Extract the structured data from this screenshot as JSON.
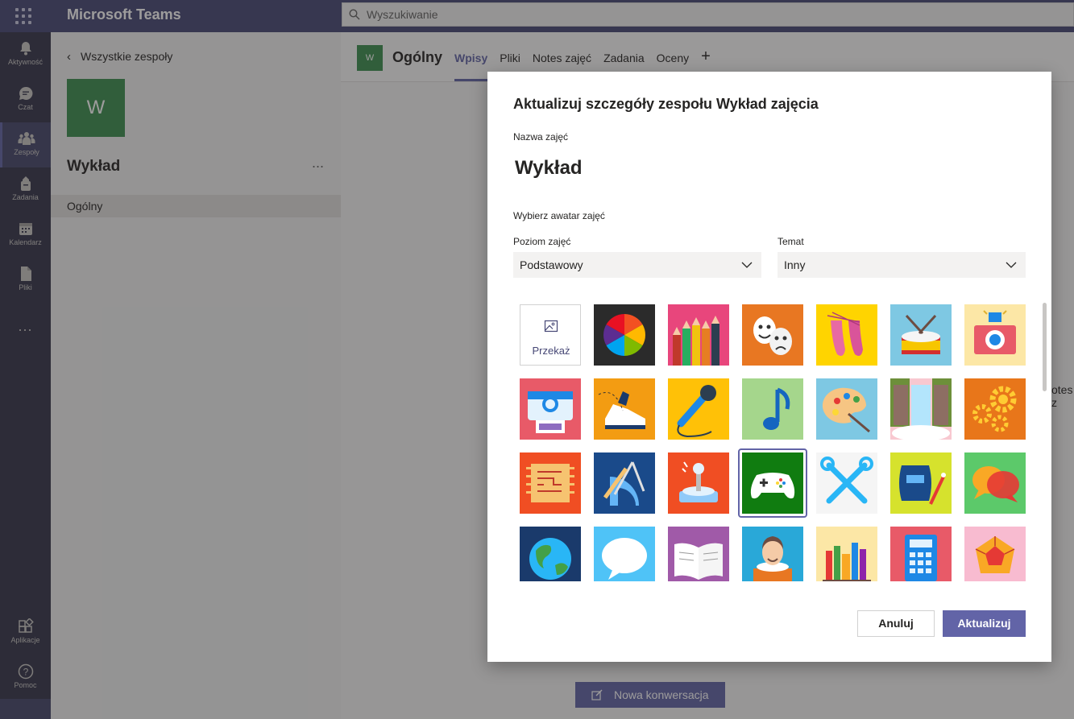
{
  "app": {
    "title": "Microsoft Teams"
  },
  "search": {
    "placeholder": "Wyszukiwanie"
  },
  "rail": {
    "items": [
      {
        "label": "Aktywność",
        "icon": "bell-icon"
      },
      {
        "label": "Czat",
        "icon": "chat-icon"
      },
      {
        "label": "Zespoły",
        "icon": "teams-icon"
      },
      {
        "label": "Zadania",
        "icon": "assignments-icon"
      },
      {
        "label": "Kalendarz",
        "icon": "calendar-icon"
      },
      {
        "label": "Pliki",
        "icon": "files-icon"
      }
    ],
    "more": "...",
    "bottom": [
      {
        "label": "Aplikacje",
        "icon": "apps-icon"
      },
      {
        "label": "Pomoc",
        "icon": "help-icon"
      }
    ]
  },
  "teampane": {
    "back_label": "Wszystkie zespoły",
    "tile_letter": "W",
    "team_name": "Wykład",
    "more": "...",
    "channel": "Ogólny"
  },
  "channel_header": {
    "tile_letter": "W",
    "title": "Ogólny",
    "tabs": [
      "Wpisy",
      "Pliki",
      "Notes zajęć",
      "Zadania",
      "Oceny"
    ],
    "active_tab": "Wpisy",
    "add_tab": "+"
  },
  "background": {
    "new_conversation": "Nowa konwersacja",
    "notes_fragment": "otes z"
  },
  "dialog": {
    "title": "Aktualizuj szczegóły zespołu Wykład zajęcia",
    "class_name_label": "Nazwa zajęć",
    "class_name": "Wykład",
    "avatar_label": "Wybierz awatar zajęć",
    "level_label": "Poziom zajęć",
    "level_value": "Podstawowy",
    "subject_label": "Temat",
    "subject_value": "Inny",
    "upload_label": "Przekaż",
    "avatars": [
      "upload-avatar",
      "color-wheel-avatar",
      "pencils-avatar",
      "theater-masks-avatar",
      "ballet-shoes-avatar",
      "drum-avatar",
      "camera-flash-avatar",
      "instant-camera-avatar",
      "running-shoe-avatar",
      "microphone-avatar",
      "music-note-avatar",
      "paint-palette-avatar",
      "waterfall-avatar",
      "gears-avatar",
      "circuit-chip-avatar",
      "geometry-tools-avatar",
      "joystick-avatar",
      "gamepad-avatar",
      "tools-avatar",
      "welding-mask-avatar",
      "chat-bubbles-avatar",
      "globe-avatar",
      "speech-bubble-avatar",
      "open-book-avatar",
      "shakespeare-avatar",
      "bookshelf-avatar",
      "calculator-avatar",
      "polyhedron-avatar"
    ],
    "selected_avatar": "gamepad-avatar",
    "cancel_label": "Anuluj",
    "update_label": "Aktualizuj"
  },
  "colors": {
    "accent": "#6264a7",
    "rail": "#33344a",
    "topbar": "#464775",
    "team_tile": "#3b8f4f"
  }
}
